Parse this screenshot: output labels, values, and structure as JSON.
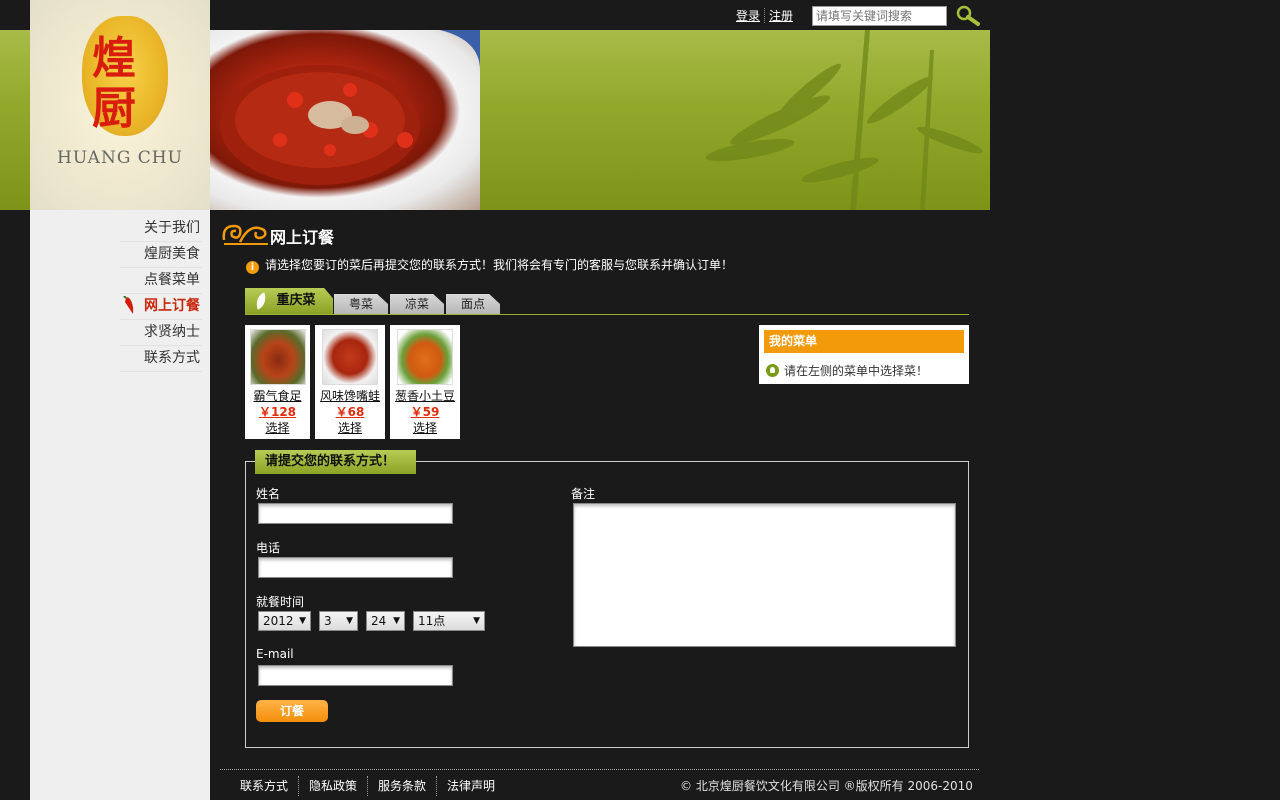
{
  "header": {
    "login_label": "登录",
    "register_label": "注册",
    "search_placeholder": "请填写关键词搜索"
  },
  "logo": {
    "char_top": "煌",
    "char_bottom": "厨",
    "english": "HUANG CHU"
  },
  "nav": {
    "items": [
      {
        "label": "关于我们"
      },
      {
        "label": "煌厨美食"
      },
      {
        "label": "点餐菜单"
      },
      {
        "label": "网上订餐"
      },
      {
        "label": "求贤纳士"
      },
      {
        "label": "联系方式"
      }
    ],
    "active_index": 3
  },
  "main": {
    "title": "网上订餐",
    "notice": "请选择您要订的菜后再提交您的联系方式！我们将会有专门的客服与您联系并确认订单！"
  },
  "tabs": [
    {
      "label": "重庆菜"
    },
    {
      "label": "粤菜"
    },
    {
      "label": "凉菜"
    },
    {
      "label": "面点"
    }
  ],
  "dishes": [
    {
      "name": "霸气食足",
      "price": "￥128",
      "select": "选择"
    },
    {
      "name": "风味馋嘴蛙",
      "price": "￥68",
      "select": "选择"
    },
    {
      "name": "葱香小土豆",
      "price": "￥59",
      "select": "选择"
    }
  ],
  "my_menu": {
    "title": "我的菜单",
    "empty_text": "请在左侧的菜单中选择菜！"
  },
  "form": {
    "legend": "请提交您的联系方式！",
    "name_label": "姓名",
    "phone_label": "电话",
    "time_label": "就餐时间",
    "year": "2012",
    "month": "3",
    "day": "24",
    "hour": "11点",
    "email_label": "E-mail",
    "notes_label": "备注",
    "submit_label": "订餐"
  },
  "footer": {
    "links": [
      {
        "label": "联系方式"
      },
      {
        "label": "隐私政策"
      },
      {
        "label": "服务条款"
      },
      {
        "label": "法律声明"
      }
    ],
    "copyright": "© 北京煌厨餐饮文化有限公司 ®版权所有 2006-2010"
  },
  "colors": {
    "accent_orange": "#f39a0b",
    "accent_green": "#8ba325",
    "price_red": "#e02d0c",
    "active_nav": "#c8280c"
  }
}
